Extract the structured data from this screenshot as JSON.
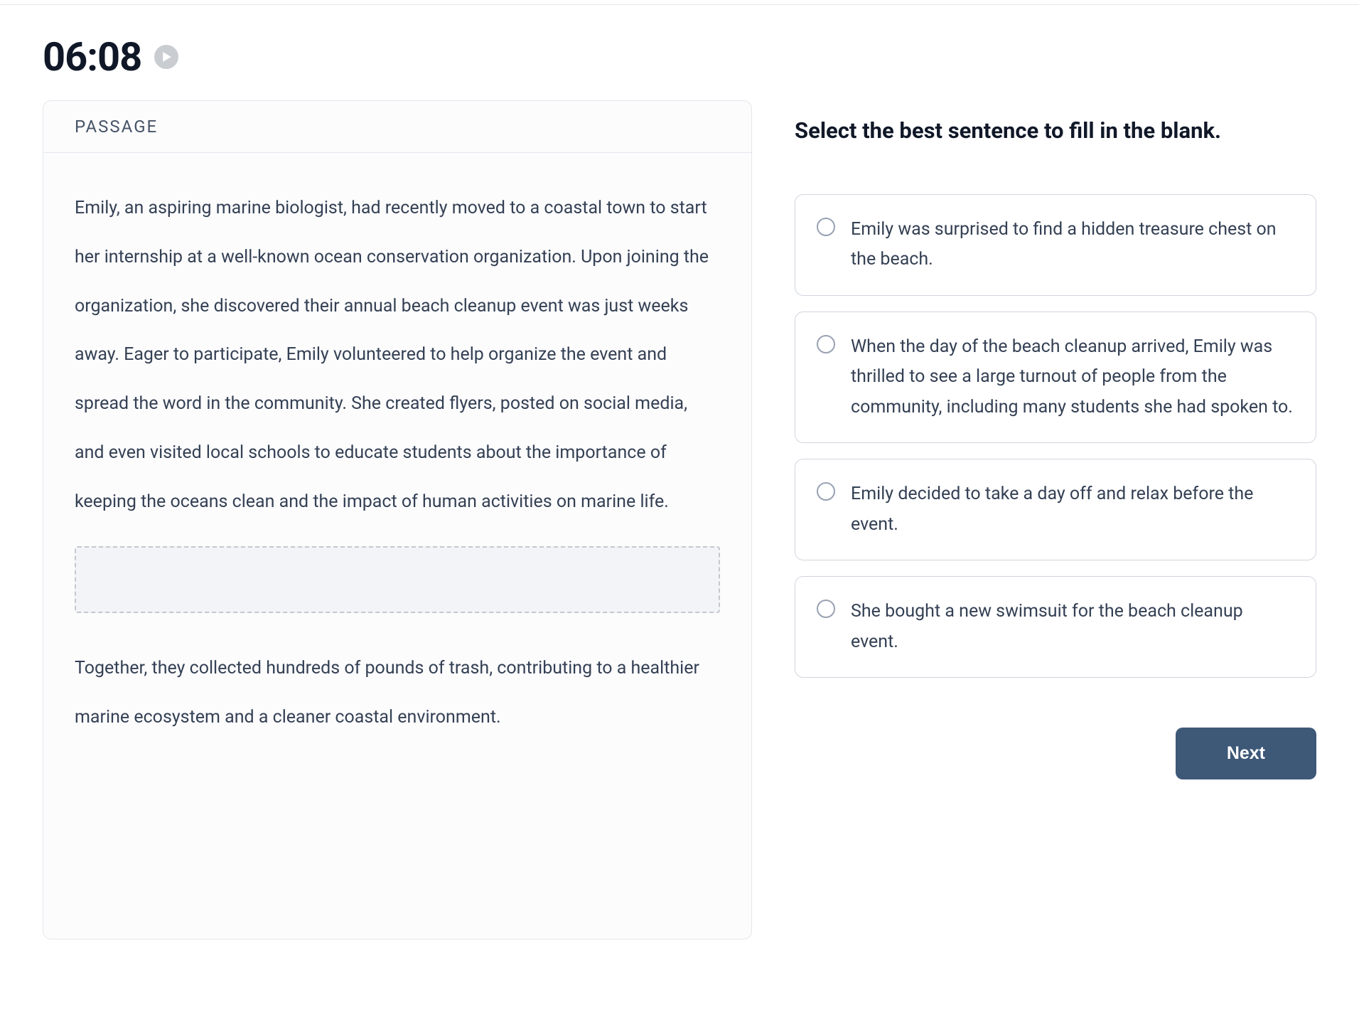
{
  "timer": "06:08",
  "passage": {
    "header": "PASSAGE",
    "paragraph1": "Emily, an aspiring marine biologist, had recently moved to a coastal town to start her internship at a well-known ocean conservation organization. Upon joining the organization, she discovered their annual beach cleanup event was just weeks away. Eager to participate, Emily volunteered to help organize the event and spread the word in the community. She created flyers, posted on social media, and even visited local schools to educate students about the importance of keeping the oceans clean and the impact of human activities on marine life.",
    "paragraph2": "Together, they collected hundreds of pounds of trash, contributing to a healthier marine ecosystem and a cleaner coastal environment."
  },
  "question": {
    "prompt": "Select the best sentence to fill in the blank.",
    "options": [
      "Emily was surprised to find a hidden treasure chest on the beach.",
      "When the day of the beach cleanup arrived, Emily was thrilled to see a large turnout of people from the community, including many students she had spoken to.",
      "Emily decided to take a day off and relax before the event.",
      "She bought a new swimsuit for the beach cleanup event."
    ]
  },
  "buttons": {
    "next": "Next"
  }
}
